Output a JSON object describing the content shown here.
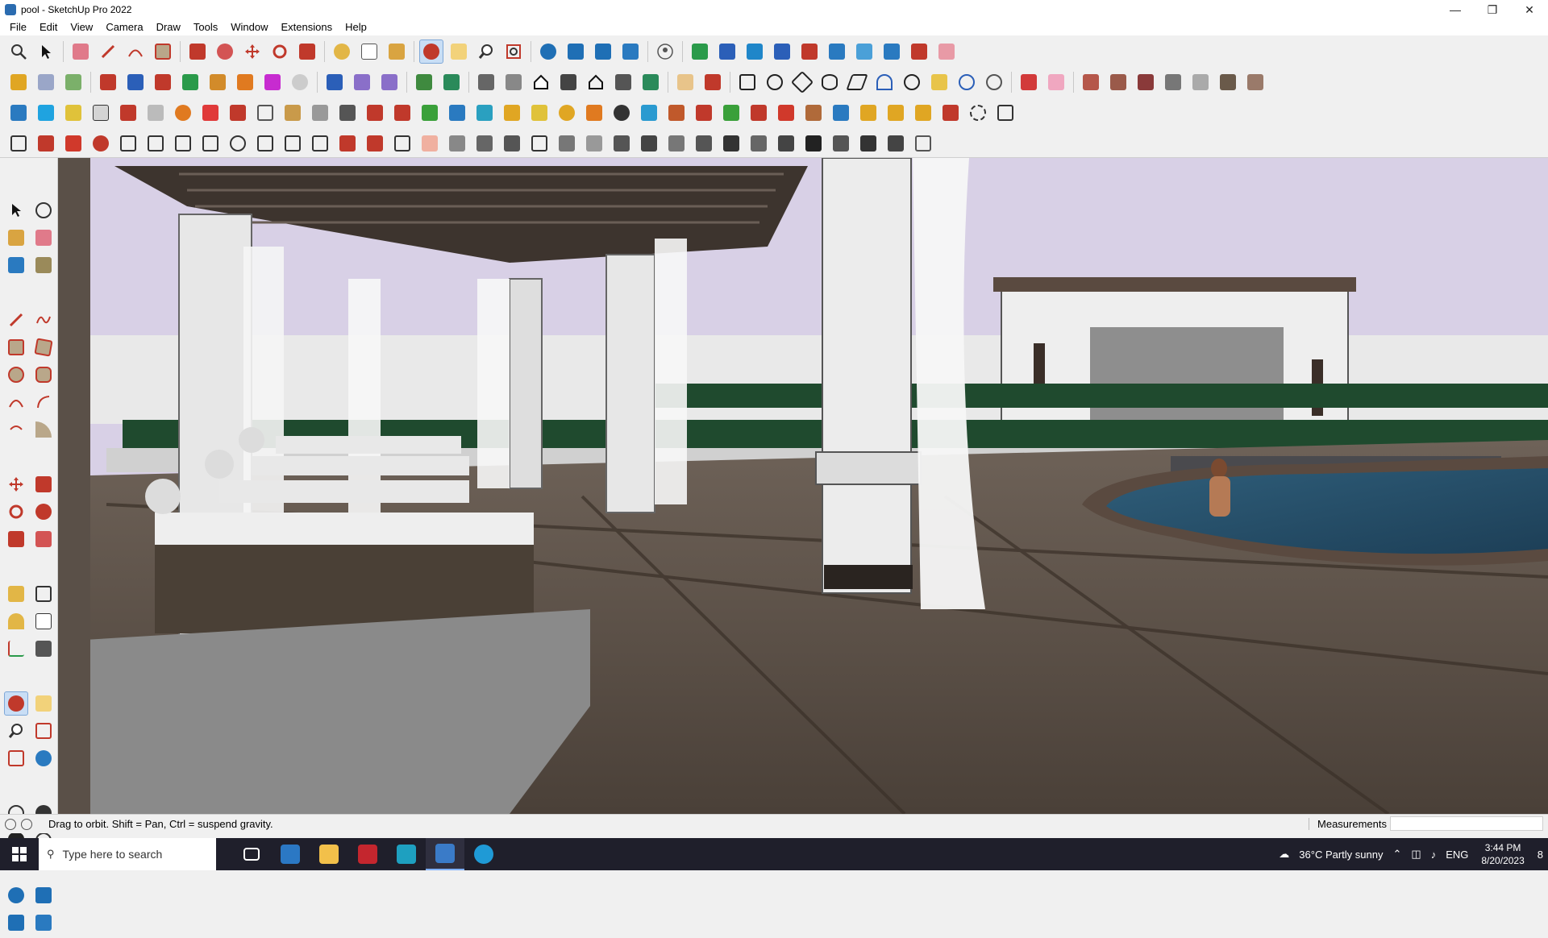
{
  "window": {
    "title": "pool - SketchUp Pro 2022",
    "min": "—",
    "max": "❐",
    "close": "✕"
  },
  "menu": [
    "File",
    "Edit",
    "View",
    "Camera",
    "Draw",
    "Tools",
    "Window",
    "Extensions",
    "Help"
  ],
  "status": {
    "message": "Drag to orbit. Shift = Pan, Ctrl = suspend gravity.",
    "measurements_label": "Measurements",
    "measurements_value": ""
  },
  "taskbar": {
    "search_placeholder": "Type here to search",
    "weather": "36°C  Partly sunny",
    "language": "ENG",
    "time": "3:44 PM",
    "date": "8/20/2023",
    "notifications": "8"
  },
  "colors": {
    "accent_active": "#c9def5",
    "sky": "#d8d0e6",
    "pool_water": "#2f5e7a",
    "hedge": "#1f4a2e"
  },
  "toolbar_icons": [
    "search-icon",
    "select-icon",
    "eraser-icon",
    "pencil-icon",
    "shape-icon",
    "rectangle-icon",
    "push-pull-icon",
    "follow-me-icon",
    "move-icon",
    "rotate-icon",
    "scale-icon",
    "tape-icon",
    "text-icon",
    "paint-icon",
    "orbit-icon",
    "pan-icon",
    "zoom-icon",
    "zoom-extents-icon",
    "section-icon",
    "layers-icon",
    "styles-icon",
    "user-icon",
    "warehouse-icon",
    "extension-icon",
    "sandbox-icon"
  ]
}
